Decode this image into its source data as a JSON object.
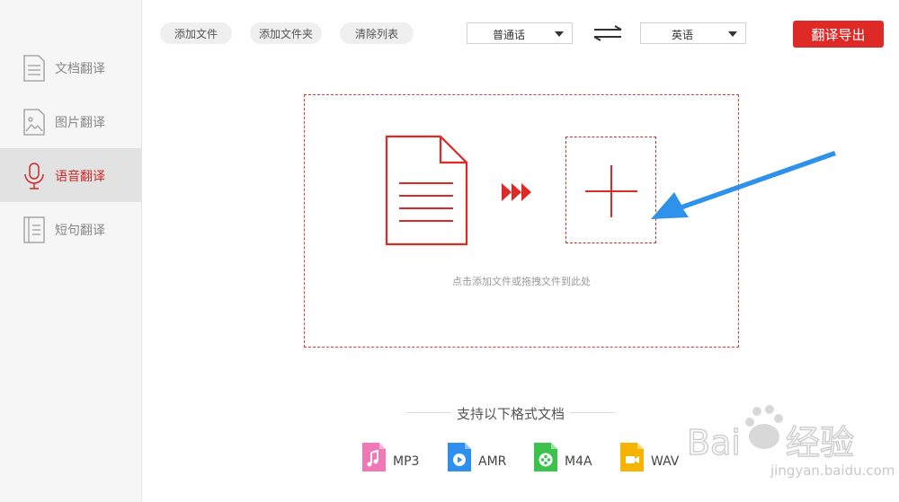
{
  "sidebar": {
    "items": [
      {
        "label": "文档翻译",
        "icon": "document-icon",
        "active": false
      },
      {
        "label": "图片翻译",
        "icon": "image-icon",
        "active": false
      },
      {
        "label": "语音翻译",
        "icon": "microphone-icon",
        "active": true
      },
      {
        "label": "短句翻译",
        "icon": "sentence-icon",
        "active": false
      }
    ]
  },
  "toolbar": {
    "add_file": "添加文件",
    "add_folder": "添加文件夹",
    "clear_list": "清除列表",
    "source_lang": "普通话",
    "target_lang": "英语",
    "export": "翻译导出"
  },
  "dropzone": {
    "hint": "点击添加文件或拖拽文件到此处"
  },
  "formats": {
    "title": "支持以下格式文档",
    "items": [
      {
        "name": "MP3",
        "color": "#f178b6",
        "icon": "music-file-icon"
      },
      {
        "name": "AMR",
        "color": "#2f8fef",
        "icon": "play-file-icon"
      },
      {
        "name": "M4A",
        "color": "#3dc24d",
        "icon": "reel-file-icon"
      },
      {
        "name": "WAV",
        "color": "#f4b400",
        "icon": "video-file-icon"
      }
    ]
  },
  "watermark": {
    "logo": "Bai du 经验",
    "url": "jingyan.baidu.com"
  },
  "colors": {
    "accent": "#de2a27",
    "arrow": "#2f92ea"
  }
}
